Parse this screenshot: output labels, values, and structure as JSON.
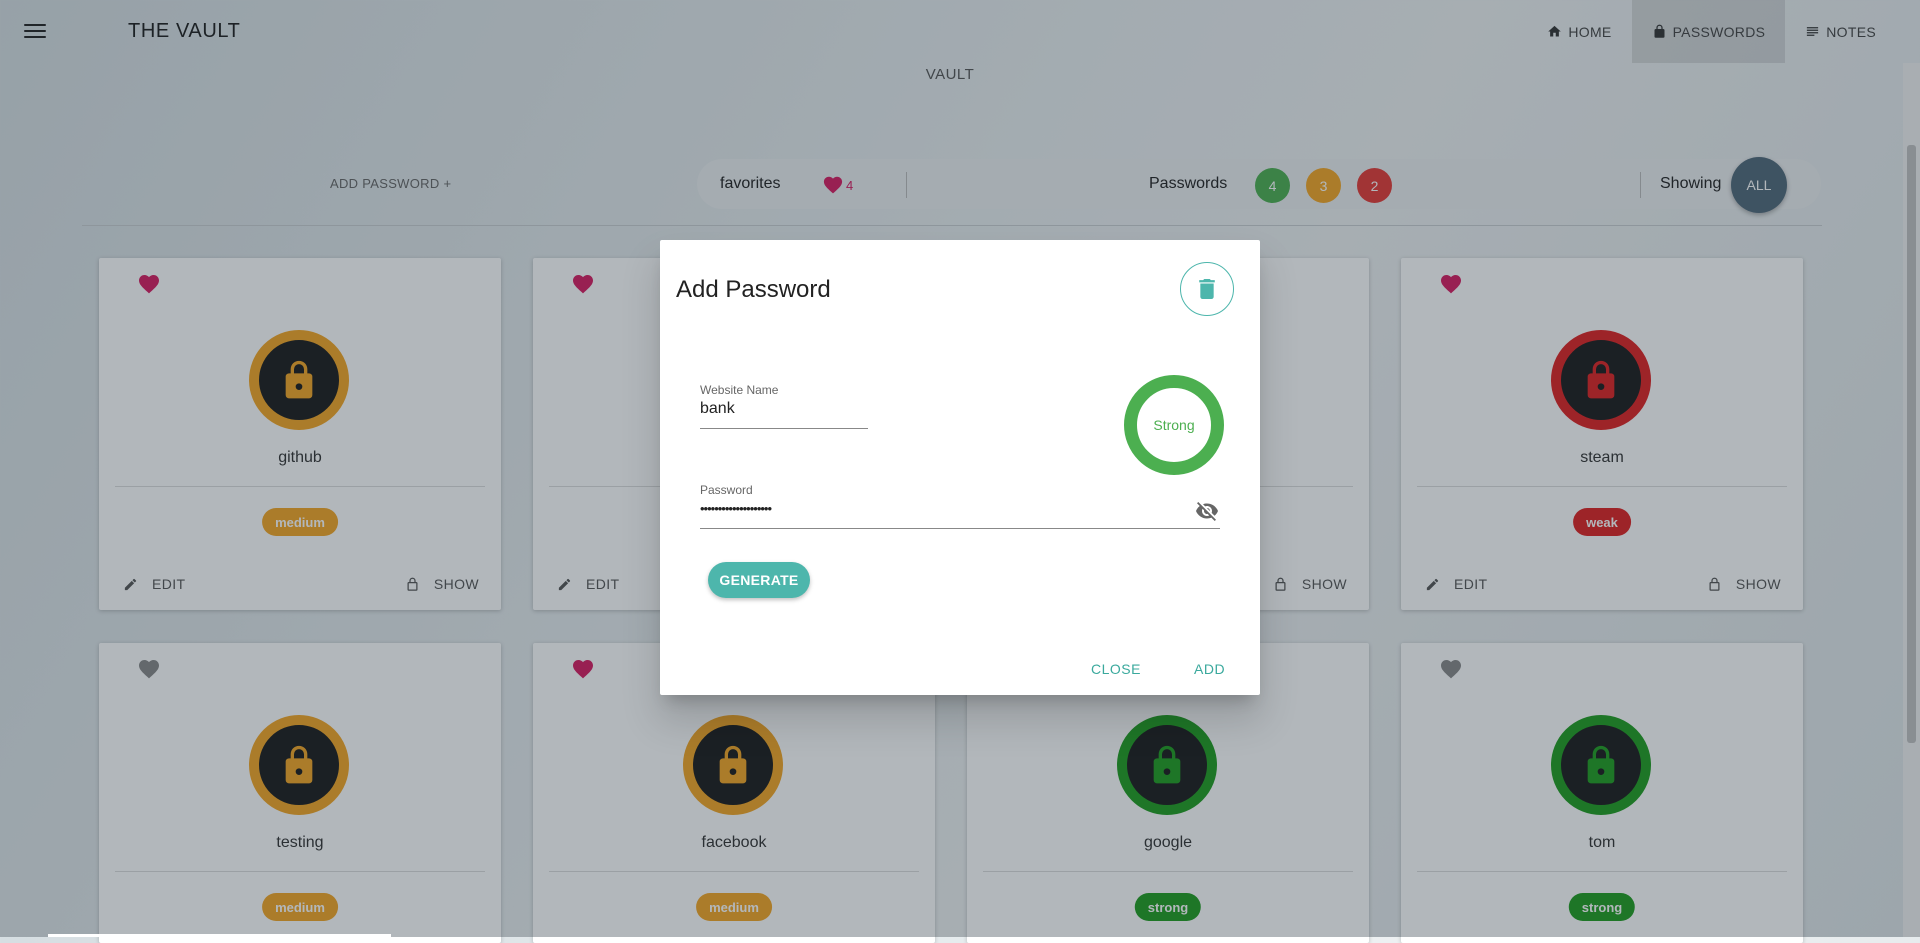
{
  "app": {
    "title": "THE VAULT",
    "subtitle": "VAULT",
    "nav": [
      {
        "label": "HOME",
        "icon": "home-icon"
      },
      {
        "label": "PASSWORDS",
        "icon": "lock-icon"
      },
      {
        "label": "NOTES",
        "icon": "notes-icon"
      }
    ]
  },
  "toolbar": {
    "add_password": "ADD PASSWORD +",
    "favorites_label": "favorites",
    "favorites_count": "4",
    "passwords_label": "Passwords",
    "counts": [
      {
        "value": "4",
        "color": "#4caf50"
      },
      {
        "value": "3",
        "color": "#f5a623"
      },
      {
        "value": "2",
        "color": "#e53935"
      }
    ],
    "showing_label": "Showing",
    "showing_value": "ALL"
  },
  "cards": [
    {
      "name": "github",
      "strength": "medium",
      "favorite": true,
      "color": "#f5a623"
    },
    {
      "name": "",
      "strength": "",
      "favorite": true,
      "color": "#f5a623"
    },
    {
      "name": "",
      "strength": "",
      "favorite": false,
      "color": "#f5a623"
    },
    {
      "name": "steam",
      "strength": "weak",
      "favorite": true,
      "color": "#e02020"
    },
    {
      "name": "testing",
      "strength": "medium",
      "favorite": false,
      "color": "#f5a623"
    },
    {
      "name": "facebook",
      "strength": "medium",
      "favorite": true,
      "color": "#f5a623"
    },
    {
      "name": "google",
      "strength": "strong",
      "favorite": false,
      "color": "#1f9d1f"
    },
    {
      "name": "tom",
      "strength": "strong",
      "favorite": false,
      "color": "#1f9d1f"
    }
  ],
  "card_actions": {
    "edit": "EDIT",
    "show": "SHOW"
  },
  "dialog": {
    "title": "Add Password",
    "website_label": "Website Name",
    "website_value": "bank",
    "password_label": "Password",
    "password_value": "••••••••••••••••••••",
    "strength_text": "Strong",
    "strength_color": "#4caf50",
    "generate": "GENERATE",
    "close": "CLOSE",
    "add": "ADD"
  },
  "colors": {
    "accent": "#4db6ac",
    "favorite": "#d81b60",
    "favorite_off": "#888888",
    "medium": "#f5a623",
    "weak": "#e02020",
    "strong": "#1f9d1f"
  }
}
